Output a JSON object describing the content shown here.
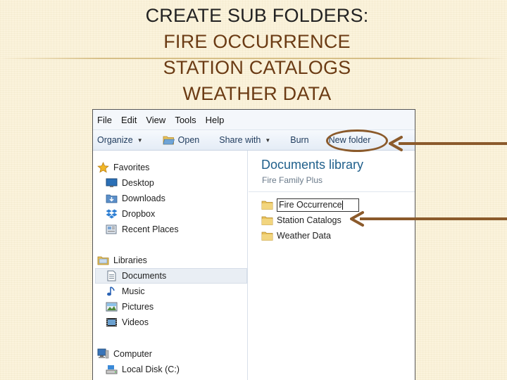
{
  "slide": {
    "title_line1": "CREATE SUB FOLDERS:",
    "title_line2": "FIRE OCCURRENCE",
    "title_line3": "STATION CATALOGS",
    "title_line4": "WEATHER DATA"
  },
  "menubar": {
    "file": "File",
    "edit": "Edit",
    "view": "View",
    "tools": "Tools",
    "help": "Help"
  },
  "toolbar": {
    "organize": "Organize",
    "open": "Open",
    "share_with": "Share with",
    "burn": "Burn",
    "new_folder": "New folder"
  },
  "nav": {
    "favorites": "Favorites",
    "desktop": "Desktop",
    "downloads": "Downloads",
    "dropbox": "Dropbox",
    "recent_places": "Recent Places",
    "libraries": "Libraries",
    "documents": "Documents",
    "music": "Music",
    "pictures": "Pictures",
    "videos": "Videos",
    "computer": "Computer",
    "local_disk": "Local Disk (C:)"
  },
  "content": {
    "library_title": "Documents library",
    "library_subtitle": "Fire Family Plus",
    "rename_value": "Fire Occurrence",
    "folders": [
      "Station Catalogs",
      "Weather Data"
    ]
  },
  "colors": {
    "accent_brown": "#8b5a2b",
    "library_title": "#1f5f8b",
    "folder_yellow": "#e8c15a"
  }
}
